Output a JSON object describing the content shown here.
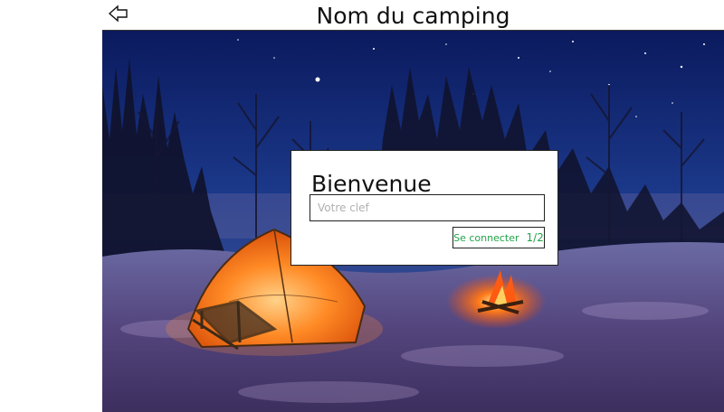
{
  "header": {
    "title": "Nom du camping",
    "back_icon": "arrow-left-icon"
  },
  "login": {
    "welcome": "Bienvenue",
    "key_placeholder": "Votre clef",
    "key_value": "",
    "button_label": "Se connecter",
    "page_indicator": "1/2"
  },
  "scene": {
    "description_icon": "camping-night-background",
    "colors": {
      "sky": "#0f1f66",
      "snow": "#5a4f86",
      "tent": "#ff7a1a",
      "fire": "#ff5a12"
    }
  }
}
